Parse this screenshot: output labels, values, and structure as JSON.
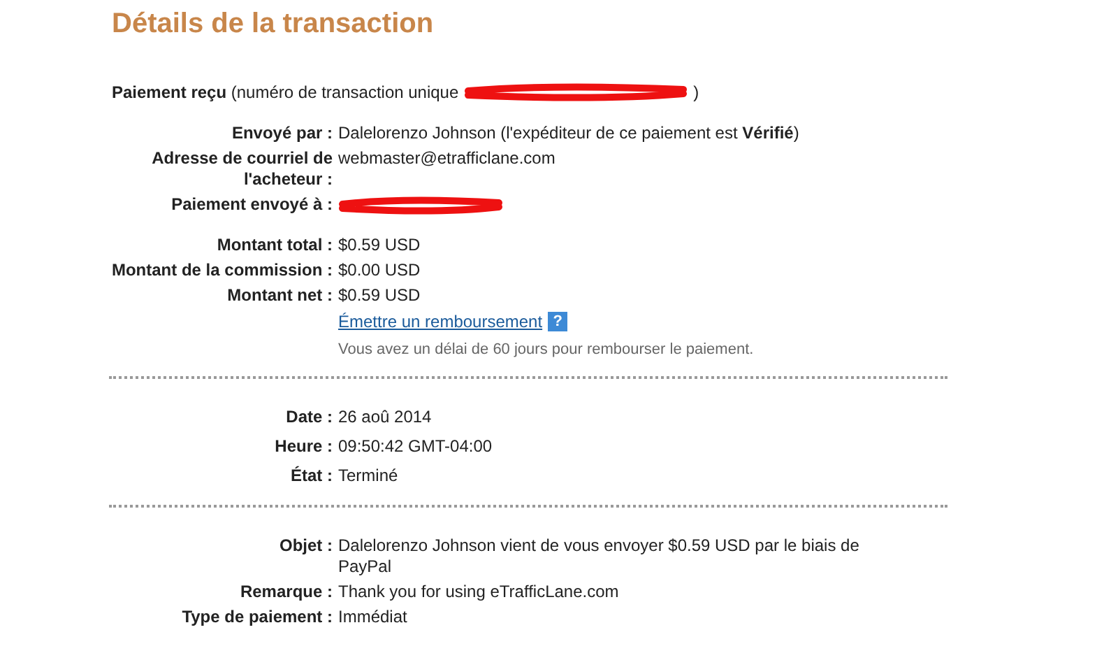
{
  "title": "Détails de la transaction",
  "payment_received": {
    "label": "Paiement reçu",
    "detail": "(numéro de transaction unique",
    "detail_end": ")"
  },
  "sender_rows": [
    {
      "label": "Envoyé par :",
      "value": "Dalelorenzo Johnson (l'expéditeur de ce paiement est **Vérifié**)",
      "kind": "text"
    },
    {
      "label": "Adresse de courriel de l'acheteur :",
      "value": "webmaster@etrafficlane.com",
      "kind": "text"
    },
    {
      "label": "Paiement envoyé à :",
      "kind": "redacted"
    }
  ],
  "amount_rows": [
    {
      "label": "Montant total :",
      "value": "$0.59 USD",
      "kind": "text"
    },
    {
      "label": "Montant de la commission :",
      "value": "$0.00 USD",
      "kind": "text"
    },
    {
      "label": "Montant net :",
      "value": "$0.59 USD",
      "kind": "text"
    }
  ],
  "refund": {
    "link": "Émettre un remboursement",
    "help_icon": "?",
    "note": "Vous avez un délai de 60 jours pour rembourser le paiement."
  },
  "date_rows": [
    {
      "label": "Date :",
      "value": "26 aoû 2014",
      "kind": "text"
    },
    {
      "label": "Heure :",
      "value": "09:50:42 GMT-04:00",
      "kind": "text"
    },
    {
      "label": "État :",
      "value": "Terminé",
      "kind": "text"
    }
  ],
  "detail_rows": [
    {
      "label": "Objet :",
      "value": "Dalelorenzo Johnson vient de vous envoyer $0.59 USD par le biais de PayPal",
      "kind": "text"
    },
    {
      "label": "Remarque :",
      "value": "Thank you for using eTrafficLane.com",
      "kind": "text"
    },
    {
      "label": "Type de paiement :",
      "value": "Immédiat",
      "kind": "text"
    }
  ]
}
